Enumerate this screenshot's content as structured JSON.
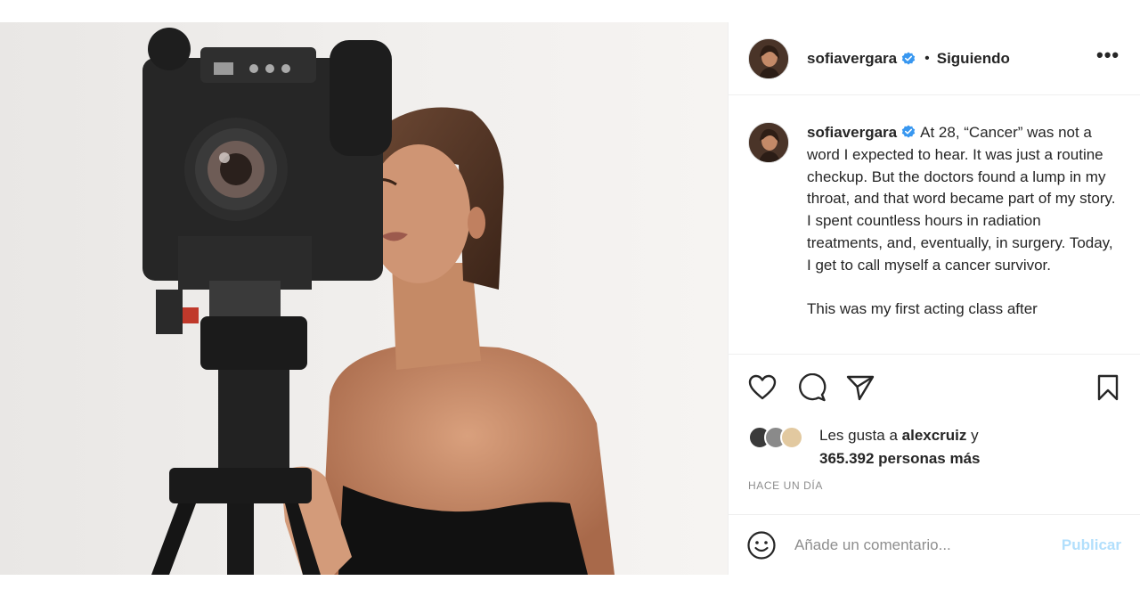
{
  "header": {
    "username": "sofiavergara",
    "separator": "•",
    "follow_status": "Siguiendo",
    "more_label": "•••"
  },
  "caption": {
    "username": "sofiavergara",
    "paragraph1": "At 28, “Cancer” was not a word I expected to hear. It was just a routine checkup. But the doctors found a lump in my throat, and that word became part of my story. I spent countless hours in radiation treatments, and, eventually, in surgery. Today, I get to call myself a cancer survivor.",
    "paragraph2": "This was my first acting class after"
  },
  "actions": {
    "like_icon": "heart-icon",
    "comment_icon": "comment-icon",
    "share_icon": "paper-plane-icon",
    "save_icon": "bookmark-icon"
  },
  "likes": {
    "prefix": "Les gusta a",
    "user": "alexcruiz",
    "connector": "y",
    "count": "365.392 personas más"
  },
  "timestamp": "HACE UN DÍA",
  "comment": {
    "placeholder": "Añade un comentario...",
    "emoji_icon": "smiley-icon",
    "publish_label": "Publicar"
  },
  "colors": {
    "text": "#262626",
    "muted": "#8e8e8e",
    "verified": "#3897f0",
    "publish_disabled": "#b2dffc",
    "divider": "#efefef"
  }
}
